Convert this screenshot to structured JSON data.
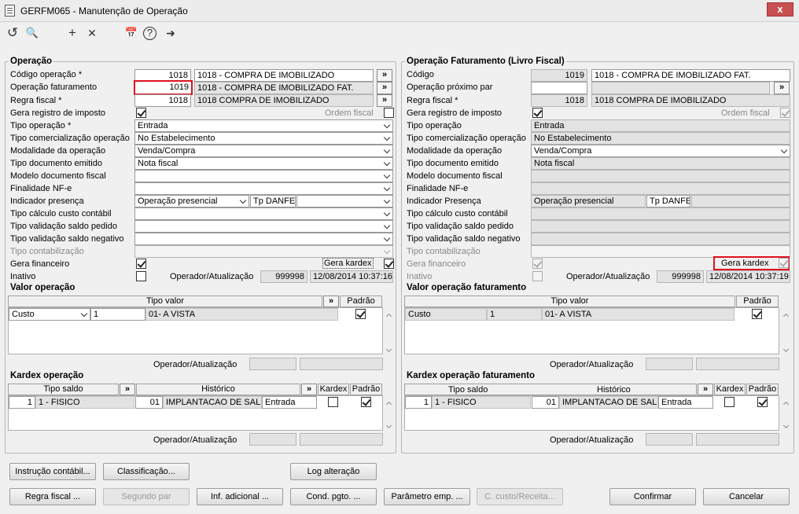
{
  "window": {
    "title": "GERFM065 - Manutenção de Operação",
    "close": "x"
  },
  "toolbar": {
    "undo": "↺",
    "search": "🔍",
    "add": "+",
    "remove": "✕",
    "calendar": "📅",
    "help": "?",
    "exit": "➜"
  },
  "left": {
    "group": "Operação",
    "codigo_label": "Código operação *",
    "codigo": "1018",
    "codigo_desc": "1018 - COMPRA DE IMOBILIZADO",
    "opfat_label": "Operação faturamento",
    "opfat": "1019",
    "opfat_desc": "1018 - COMPRA DE IMOBILIZADO FAT.",
    "regra_label": "Regra fiscal *",
    "regra": "1018",
    "regra_desc": "1018 COMPRA DE IMOBILIZADO",
    "gera_reg_label": "Gera registro de imposto",
    "ordem_fiscal": "Ordem fiscal",
    "tipo_op_label": "Tipo operação *",
    "tipo_op": "Entrada",
    "tipo_com_label": "Tipo comercialização operação",
    "tipo_com": "No Estabelecimento",
    "modal_label": "Modalidade da operação",
    "modal": "Venda/Compra",
    "tipo_doc_label": "Tipo documento emitido",
    "tipo_doc": "Nota fiscal",
    "modelo_label": "Modelo documento fiscal",
    "final_label": "Finalidade NF-e",
    "ind_label": "Indicador presença",
    "ind": "Operação presencial",
    "tp_danfe": "Tp DANFE",
    "calc_label": "Tipo cálculo custo contábil",
    "val_ped_label": "Tipo validação saldo pedido",
    "val_neg_label": "Tipo validação saldo negativo",
    "contab_label": "Tipo contabilização",
    "gera_fin_label": "Gera financeiro",
    "gera_kardex": "Gera kardex",
    "inativo_label": "Inativo",
    "oper_label": "Operador/Atualização",
    "oper": "999998",
    "data": "12/08/2014 10:37:16",
    "valor_group": "Valor operação",
    "tipo_valor": "Tipo valor",
    "padrao": "Padrão",
    "valor_row": {
      "c1": "Custo",
      "c2": "1",
      "c3": "01- A VISTA"
    },
    "valor_oper_label": "Operador/Atualização",
    "kardex_group": "Kardex operação",
    "tipo_saldo": "Tipo saldo",
    "historico": "Histórico",
    "kardex": "Kardex",
    "padrao2": "Padrão",
    "kardex_row": {
      "c1": "1",
      "c2": "1 - FISICO",
      "c3": "01",
      "c4": "IMPLANTACAO DE SALDO",
      "c5": "Entrada"
    },
    "kardex_oper_label": "Operador/Atualização"
  },
  "right": {
    "group": "Operação Faturamento (Livro Fiscal)",
    "codigo_label": "Código",
    "codigo": "1019",
    "codigo_desc": "1018 - COMPRA DE IMOBILIZADO FAT.",
    "prox_label": "Operação próximo par",
    "regra_label": "Regra fiscal *",
    "regra": "1018",
    "regra_desc": "1018 COMPRA DE IMOBILIZADO",
    "gera_reg_label": "Gera registro de imposto",
    "ordem_fiscal": "Ordem fiscal",
    "tipo_op_label": "Tipo operação",
    "tipo_op": "Entrada",
    "tipo_com_label": "Tipo comercialização operação",
    "tipo_com": "No Estabelecimento",
    "modal_label": "Modalidade da operação",
    "modal": "Venda/Compra",
    "tipo_doc_label": "Tipo documento emitido",
    "tipo_doc": "Nota fiscal",
    "modelo_label": "Modelo documento fiscal",
    "final_label": "Finalidade NF-e",
    "ind_label": "Indicador Presença",
    "ind": "Operação presencial",
    "tp_danfe": "Tp DANFE",
    "calc_label": "Tipo cálculo custo contábil",
    "val_ped_label": "Tipo validação saldo pedido",
    "val_neg_label": "Tipo validação saldo negativo",
    "contab_label": "Tipo contabilização",
    "gera_fin_label": "Gera financeiro",
    "gera_kardex": "Gera kardex",
    "inativo_label": "Inativo",
    "oper_label": "Operador/Atualização",
    "oper": "999998",
    "data": "12/08/2014 10:37:19",
    "valor_group": "Valor operação faturamento",
    "tipo_valor": "Tipo valor",
    "padrao": "Padrão",
    "valor_row": {
      "c1": "Custo",
      "c2": "1",
      "c3": "01- A VISTA"
    },
    "valor_oper_label": "Operador/Atualização",
    "kardex_group": "Kardex operação faturamento",
    "tipo_saldo": "Tipo saldo",
    "historico": "Histórico",
    "kardex": "Kardex",
    "padrao2": "Padrão",
    "kardex_row": {
      "c1": "1",
      "c2": "1 - FISICO",
      "c3": "01",
      "c4": "IMPLANTACAO DE SALDO",
      "c5": "Entrada"
    },
    "kardex_oper_label": "Operador/Atualização"
  },
  "buttons": {
    "instr": "Instrução contábil...",
    "class": "Classificação...",
    "log": "Log alteração",
    "regra": "Regra fiscal ...",
    "segundo": "Segundo par",
    "inf": "Inf. adicional ...",
    "cond": "Cond. pgto. ...",
    "param": "Parâmetro emp. ...",
    "custo": "C. custo/Receita...",
    "confirmar": "Confirmar",
    "cancelar": "Cancelar"
  },
  "more": "»"
}
